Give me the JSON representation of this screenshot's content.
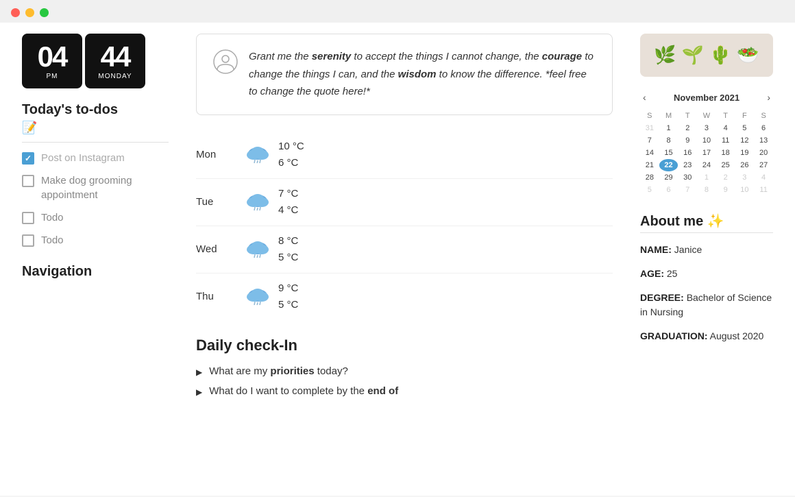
{
  "titlebar": {
    "lights": [
      "red",
      "yellow",
      "green"
    ]
  },
  "clock": {
    "hours": "04",
    "minutes": "44",
    "period": "PM",
    "day": "MONDAY"
  },
  "todos": {
    "section_title": "Today's to-dos",
    "edit_icon": "📝",
    "items": [
      {
        "id": 1,
        "text": "Post on Instagram",
        "checked": true
      },
      {
        "id": 2,
        "text": "Make dog grooming appointment",
        "checked": false
      },
      {
        "id": 3,
        "text": "Todo",
        "checked": false
      },
      {
        "id": 4,
        "text": "Todo",
        "checked": false
      }
    ]
  },
  "navigation": {
    "title": "Navigation"
  },
  "quote": {
    "icon": "👤",
    "text_parts": [
      {
        "text": "Grant me the ",
        "bold": false
      },
      {
        "text": "serenity",
        "bold": true
      },
      {
        "text": " to accept the things I cannot change, the ",
        "bold": false
      },
      {
        "text": "courage",
        "bold": true
      },
      {
        "text": " to change the things I can, and the ",
        "bold": false
      },
      {
        "text": "wisdom",
        "bold": true
      },
      {
        "text": " to know the difference. *feel free to change the quote here!*",
        "bold": false
      }
    ],
    "full_text": "Grant me the serenity to accept the things I cannot change, the courage to change the things I can, and the wisdom to know the difference. *feel free to change the quote here!*"
  },
  "weather": {
    "days": [
      {
        "day": "Mon",
        "high": "10 °C",
        "low": "6 °C"
      },
      {
        "day": "Tue",
        "high": "7 °C",
        "low": "4 °C"
      },
      {
        "day": "Wed",
        "high": "8 °C",
        "low": "5 °C"
      },
      {
        "day": "Thu",
        "high": "9 °C",
        "low": "5 °C"
      }
    ]
  },
  "checkin": {
    "title": "Daily check-In",
    "items": [
      {
        "text_start": "What are my ",
        "bold": "priorities",
        "text_end": " today?"
      },
      {
        "text_start": "What do I want to complete by the ",
        "bold": "end of",
        "text_end": ""
      }
    ]
  },
  "plants": {
    "emojis": [
      "🌿",
      "🌱",
      "🌵",
      "🥗"
    ]
  },
  "calendar": {
    "month": "November 2021",
    "days_header": [
      "S",
      "M",
      "T",
      "W",
      "T",
      "F",
      "S"
    ],
    "weeks": [
      [
        {
          "n": "31",
          "m": true
        },
        {
          "n": "1"
        },
        {
          "n": "2"
        },
        {
          "n": "3"
        },
        {
          "n": "4"
        },
        {
          "n": "5"
        },
        {
          "n": "6"
        }
      ],
      [
        {
          "n": "7"
        },
        {
          "n": "8"
        },
        {
          "n": "9"
        },
        {
          "n": "10"
        },
        {
          "n": "11"
        },
        {
          "n": "12"
        },
        {
          "n": "13"
        }
      ],
      [
        {
          "n": "14"
        },
        {
          "n": "15"
        },
        {
          "n": "16"
        },
        {
          "n": "17"
        },
        {
          "n": "18"
        },
        {
          "n": "19"
        },
        {
          "n": "20"
        }
      ],
      [
        {
          "n": "21"
        },
        {
          "n": "22"
        },
        {
          "n": "23"
        },
        {
          "n": "24"
        },
        {
          "n": "25"
        },
        {
          "n": "26"
        },
        {
          "n": "27"
        }
      ],
      [
        {
          "n": "28"
        },
        {
          "n": "29"
        },
        {
          "n": "30"
        },
        {
          "n": "1",
          "m": true
        },
        {
          "n": "2",
          "m": true
        },
        {
          "n": "3",
          "m": true
        },
        {
          "n": "4",
          "m": true
        }
      ],
      [
        {
          "n": "5",
          "m": true
        },
        {
          "n": "6",
          "m": true
        },
        {
          "n": "7",
          "m": true
        },
        {
          "n": "8",
          "m": true
        },
        {
          "n": "9",
          "m": true
        },
        {
          "n": "10",
          "m": true
        },
        {
          "n": "11",
          "m": true
        }
      ]
    ],
    "today": "22"
  },
  "about": {
    "title": "About me",
    "sparkle": "✨",
    "fields": [
      {
        "label": "NAME",
        "value": "Janice"
      },
      {
        "label": "AGE",
        "value": "25"
      },
      {
        "label": "DEGREE",
        "value": "Bachelor of Science in Nursing"
      },
      {
        "label": "GRADUATION",
        "value": "August 2020"
      }
    ]
  }
}
